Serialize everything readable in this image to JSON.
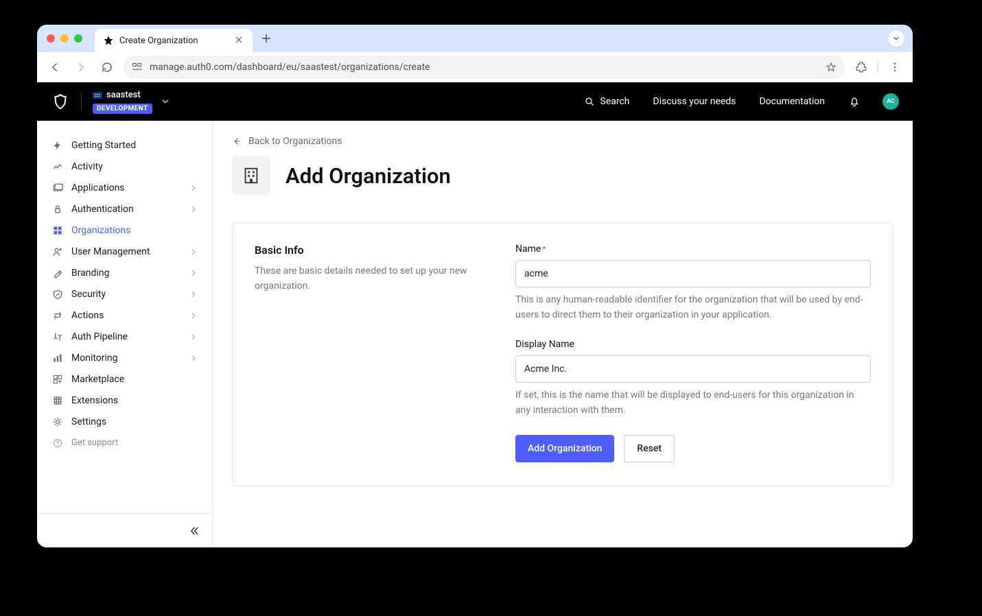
{
  "browser": {
    "tab_title": "Create Organization",
    "url": "manage.auth0.com/dashboard/eu/saastest/organizations/create"
  },
  "header": {
    "tenant_name": "saastest",
    "env_badge": "DEVELOPMENT",
    "search_label": "Search",
    "discuss_label": "Discuss your needs",
    "docs_label": "Documentation",
    "avatar_initials": "AC"
  },
  "sidebar": {
    "items": [
      {
        "label": "Getting Started",
        "chev": false
      },
      {
        "label": "Activity",
        "chev": false
      },
      {
        "label": "Applications",
        "chev": true
      },
      {
        "label": "Authentication",
        "chev": true
      },
      {
        "label": "Organizations",
        "chev": false,
        "active": true
      },
      {
        "label": "User Management",
        "chev": true
      },
      {
        "label": "Branding",
        "chev": true
      },
      {
        "label": "Security",
        "chev": true
      },
      {
        "label": "Actions",
        "chev": true
      },
      {
        "label": "Auth Pipeline",
        "chev": true
      },
      {
        "label": "Monitoring",
        "chev": true
      },
      {
        "label": "Marketplace",
        "chev": false
      },
      {
        "label": "Extensions",
        "chev": false
      },
      {
        "label": "Settings",
        "chev": false
      }
    ],
    "support_label": "Get support"
  },
  "main": {
    "back_label": "Back to Organizations",
    "title": "Add Organization",
    "section_title": "Basic Info",
    "section_desc": "These are basic details needed to set up your new organization.",
    "name_label": "Name",
    "name_value": "acme",
    "name_help": "This is any human-readable identifier for the organization that will be used by end-users to direct them to their organization in your application.",
    "display_label": "Display Name",
    "display_value": "Acme Inc.",
    "display_help": "If set, this is the name that will be displayed to end-users for this organization in any interaction with them.",
    "submit_label": "Add Organization",
    "reset_label": "Reset"
  },
  "colors": {
    "accent": "#4d5dff"
  }
}
